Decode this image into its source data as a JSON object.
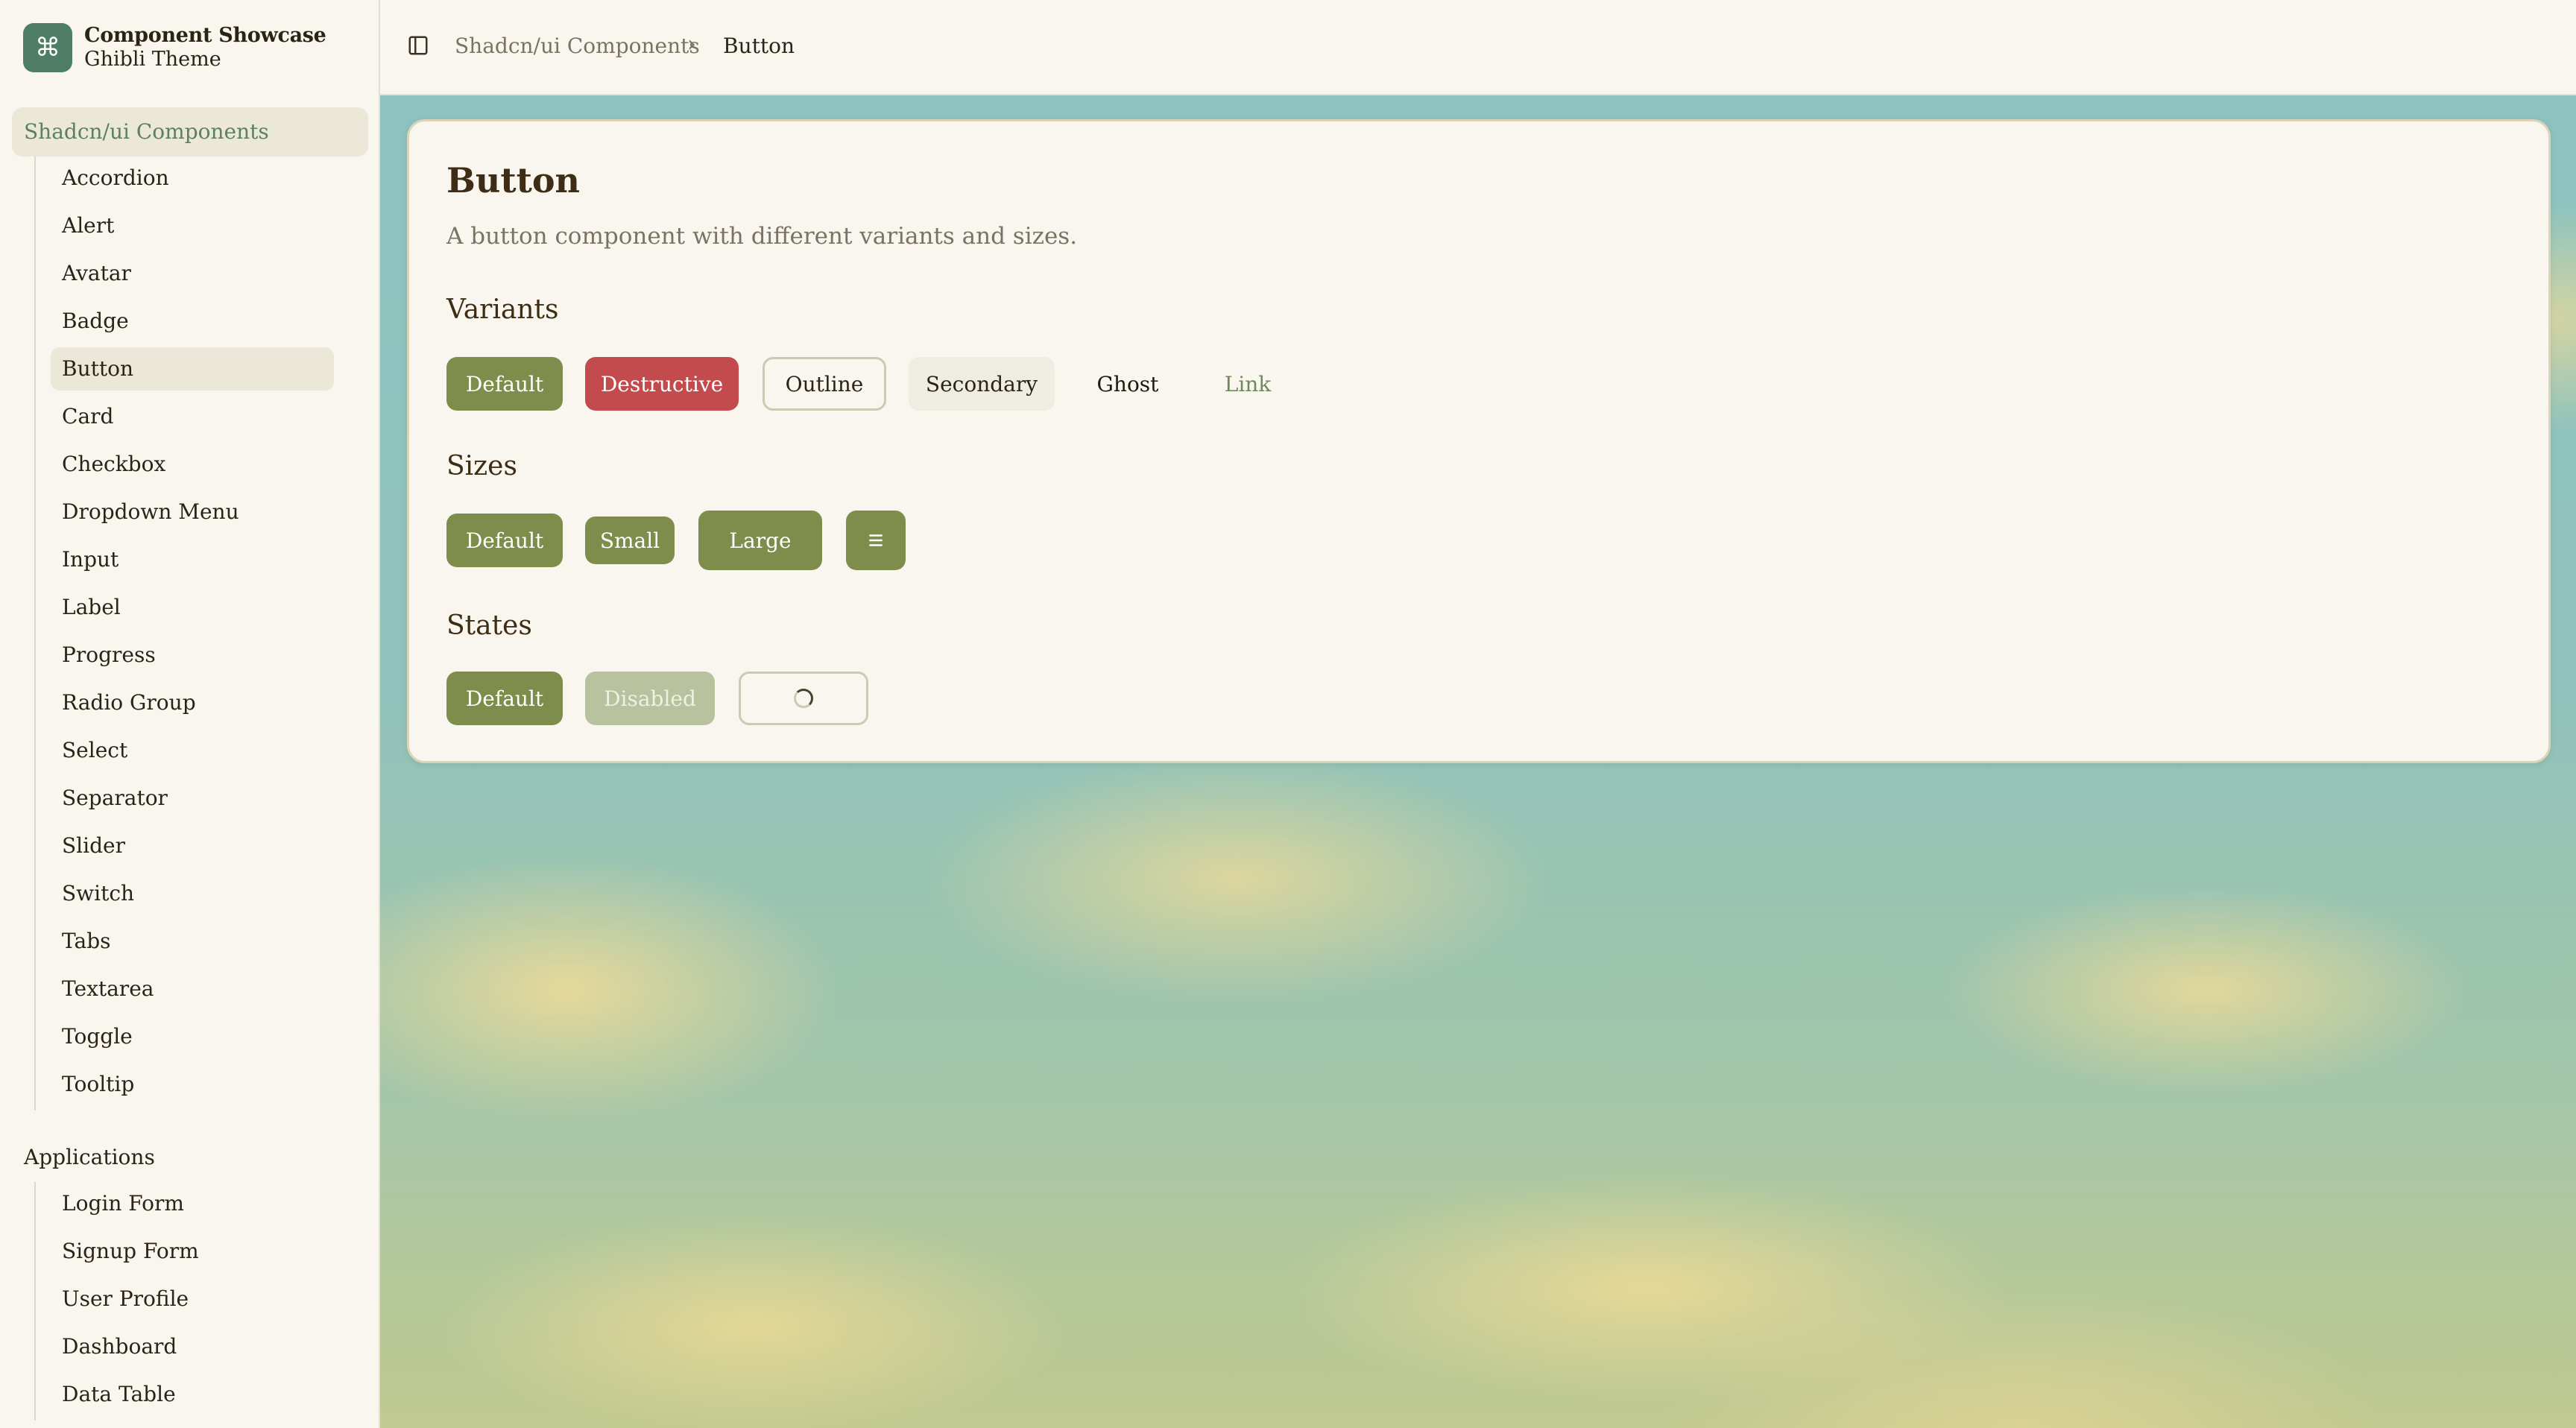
{
  "brand": {
    "title": "Component Showcase",
    "subtitle": "Ghibli Theme",
    "logo_icon": "command-icon"
  },
  "sidebar": {
    "group1": {
      "label": "Shadcn/ui Components",
      "items": [
        "Accordion",
        "Alert",
        "Avatar",
        "Badge",
        "Button",
        "Card",
        "Checkbox",
        "Dropdown Menu",
        "Input",
        "Label",
        "Progress",
        "Radio Group",
        "Select",
        "Separator",
        "Slider",
        "Switch",
        "Tabs",
        "Textarea",
        "Toggle",
        "Tooltip"
      ],
      "active": "Button"
    },
    "group2": {
      "label": "Applications",
      "items": [
        "Login Form",
        "Signup Form",
        "User Profile",
        "Dashboard",
        "Data Table"
      ]
    }
  },
  "breadcrumb": {
    "parent": "Shadcn/ui Components",
    "current": "Button"
  },
  "card": {
    "title": "Button",
    "description": "A button component with different variants and sizes.",
    "variants": {
      "heading": "Variants",
      "buttons": [
        "Default",
        "Destructive",
        "Outline",
        "Secondary",
        "Ghost",
        "Link"
      ]
    },
    "sizes": {
      "heading": "Sizes",
      "buttons": [
        "Default",
        "Small",
        "Large"
      ],
      "icon_button": "menu-icon"
    },
    "states": {
      "heading": "States",
      "buttons": [
        "Default",
        "Disabled"
      ],
      "loading_icon": "spinner-icon"
    }
  },
  "colors": {
    "primary": "#7e8d4c",
    "destructive": "#c34b4e",
    "brand": "#4e7c64",
    "link": "#6f8a59"
  }
}
